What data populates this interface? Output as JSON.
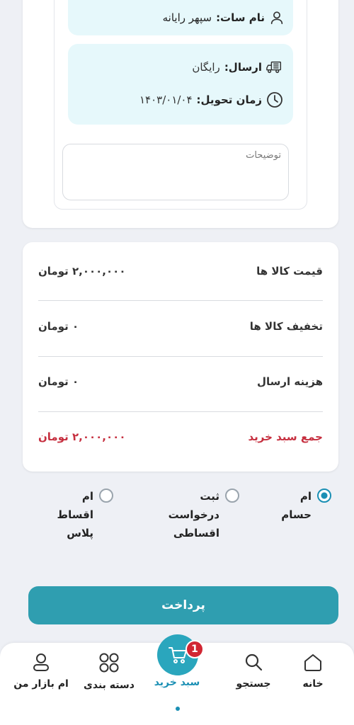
{
  "shop": {
    "label": "نام سات:",
    "value": "سپهر رایانه"
  },
  "shipping": {
    "send_label": "ارسال:",
    "send_value": "رایگان",
    "delivery_label": "زمان تحویل:",
    "delivery_value": "۱۴۰۳/۰۱/۰۴"
  },
  "description": {
    "placeholder": "توضیحات"
  },
  "summary": {
    "items_price_label": "قیمت کالا ها",
    "items_price_value": "۲,۰۰۰,۰۰۰ تومان",
    "discount_label": "تخفیف کالا ها",
    "discount_value": "۰ تومان",
    "shipping_cost_label": "هزینه ارسال",
    "shipping_cost_value": "۰ تومان",
    "total_label": "جمع سبد خرید",
    "total_value": "۲,۰۰۰,۰۰۰ تومان"
  },
  "payment_options": [
    {
      "label": "ام\nحسام",
      "selected": true
    },
    {
      "label": "ثبت\nدرخواست\nاقساطی",
      "selected": false
    },
    {
      "label": "ام\nاقساط\nپلاس",
      "selected": false
    }
  ],
  "pay_button": "پرداخت",
  "nav": {
    "home": "خانه",
    "search": "جستجو",
    "cart": "سبد خرید",
    "categories": "دسته بندی",
    "profile": "ام بازار من",
    "cart_badge": "1"
  },
  "colors": {
    "accent": "#2f9eb0",
    "total": "#c62f3f",
    "badge": "#d12633"
  }
}
